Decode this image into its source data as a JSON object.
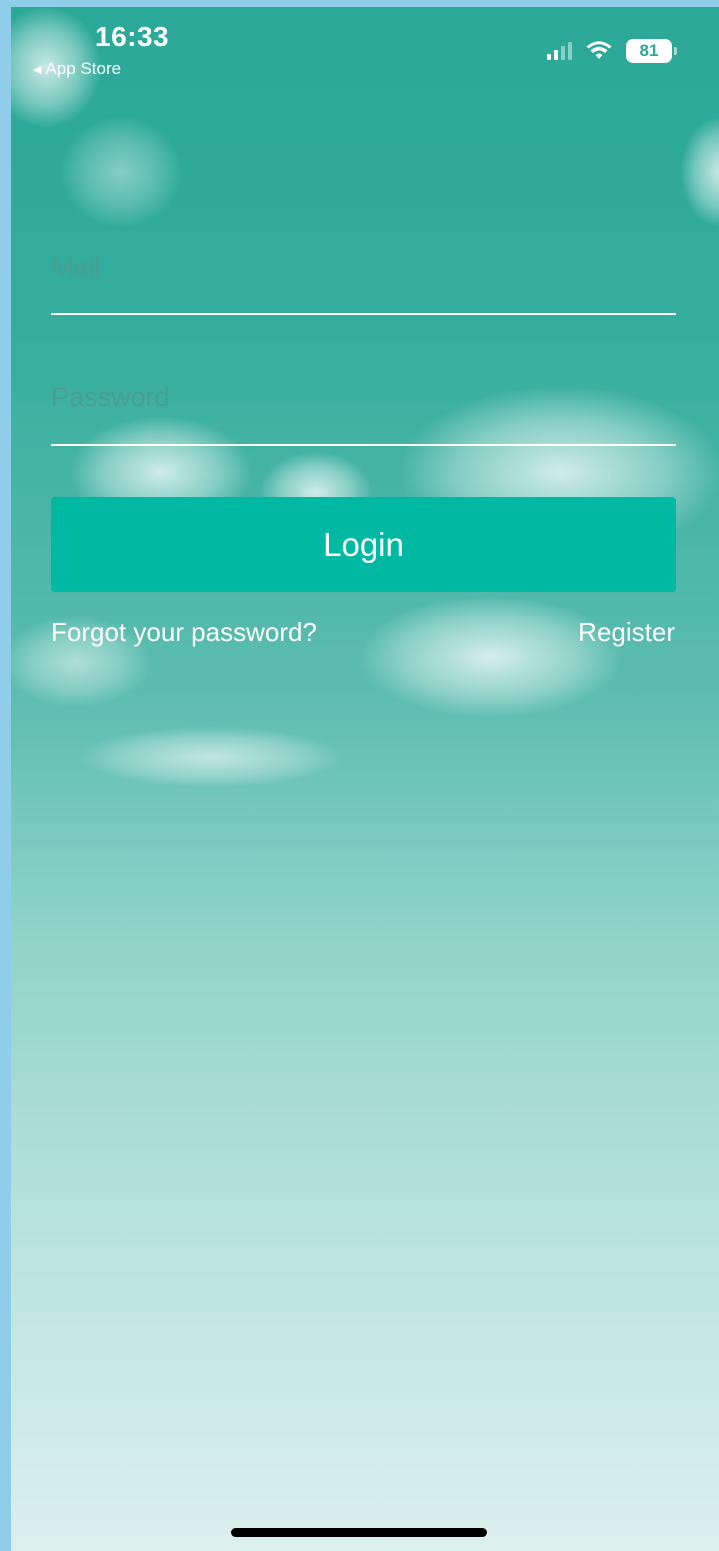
{
  "status_bar": {
    "time": "16:33",
    "back_label": "App Store",
    "battery_level": "81",
    "signal_bars_active": 2,
    "signal_bars_total": 4
  },
  "login_form": {
    "mail_placeholder": "Mail",
    "mail_value": "",
    "password_placeholder": "Password",
    "password_value": "",
    "login_label": "Login",
    "forgot_label": "Forgot your password?",
    "register_label": "Register"
  },
  "colors": {
    "background_top": "#2aa898",
    "background_bottom": "#dcf0ee",
    "button": "#00b9a2",
    "text": "#ffffff"
  }
}
